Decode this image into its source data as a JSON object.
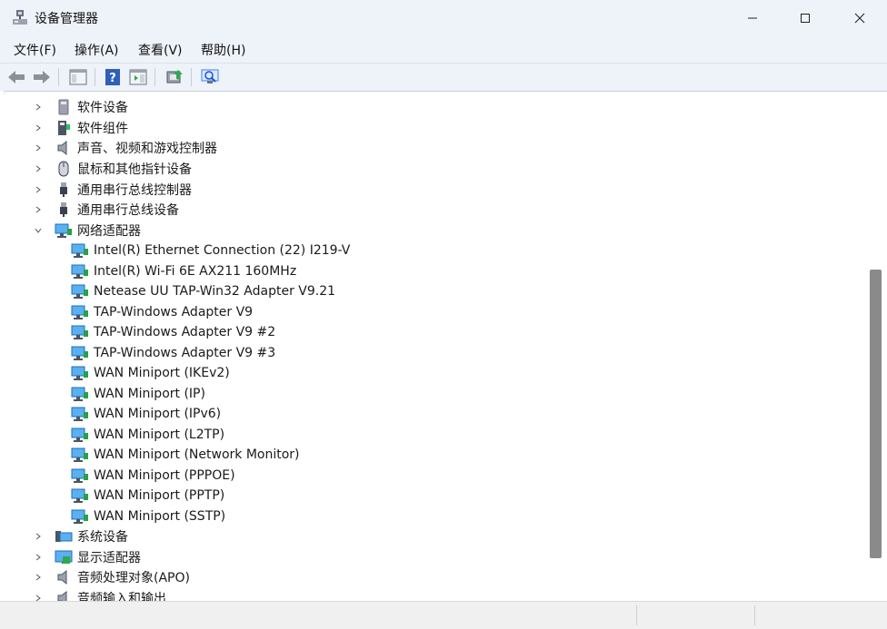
{
  "window": {
    "title": "设备管理器",
    "controls": {
      "minimize": "minimize-icon",
      "maximize": "maximize-icon",
      "close": "close-icon"
    }
  },
  "menu": {
    "items": [
      {
        "label": "文件(F)"
      },
      {
        "label": "操作(A)"
      },
      {
        "label": "查看(V)"
      },
      {
        "label": "帮助(H)"
      }
    ]
  },
  "toolbar": {
    "buttons": [
      "back-icon",
      "forward-icon",
      "show-hide-console-tree-icon",
      "help-icon",
      "properties-panel-icon",
      "update-driver-icon",
      "scan-hardware-icon"
    ]
  },
  "tree": {
    "items": [
      {
        "label": "软件设备",
        "expanded": false,
        "icon": "software-device-icon"
      },
      {
        "label": "软件组件",
        "expanded": false,
        "icon": "software-component-icon"
      },
      {
        "label": "声音、视频和游戏控制器",
        "expanded": false,
        "icon": "speaker-icon"
      },
      {
        "label": "鼠标和其他指针设备",
        "expanded": false,
        "icon": "mouse-icon"
      },
      {
        "label": "通用串行总线控制器",
        "expanded": false,
        "icon": "usb-icon"
      },
      {
        "label": "通用串行总线设备",
        "expanded": false,
        "icon": "usb-icon"
      },
      {
        "label": "网络适配器",
        "expanded": true,
        "icon": "network-adapter-icon"
      },
      {
        "label": "系统设备",
        "expanded": false,
        "icon": "system-device-icon"
      },
      {
        "label": "显示适配器",
        "expanded": false,
        "icon": "display-adapter-icon"
      },
      {
        "label": "音频处理对象(APO)",
        "expanded": false,
        "icon": "speaker-icon"
      },
      {
        "label": "音频输入和输出",
        "expanded": false,
        "icon": "speaker-icon"
      }
    ],
    "network_children": [
      "Intel(R) Ethernet Connection (22) I219-V",
      "Intel(R) Wi-Fi 6E AX211 160MHz",
      "Netease UU TAP-Win32 Adapter V9.21",
      "TAP-Windows Adapter V9",
      "TAP-Windows Adapter V9 #2",
      "TAP-Windows Adapter V9 #3",
      "WAN Miniport (IKEv2)",
      "WAN Miniport (IP)",
      "WAN Miniport (IPv6)",
      "WAN Miniport (L2TP)",
      "WAN Miniport (Network Monitor)",
      "WAN Miniport (PPPOE)",
      "WAN Miniport (PPTP)",
      "WAN Miniport (SSTP)"
    ]
  },
  "colors": {
    "titlebar_bg": "#eef3f9",
    "network_icon": "#2f8fd8",
    "scroll_thumb": "#8a8a8a"
  }
}
